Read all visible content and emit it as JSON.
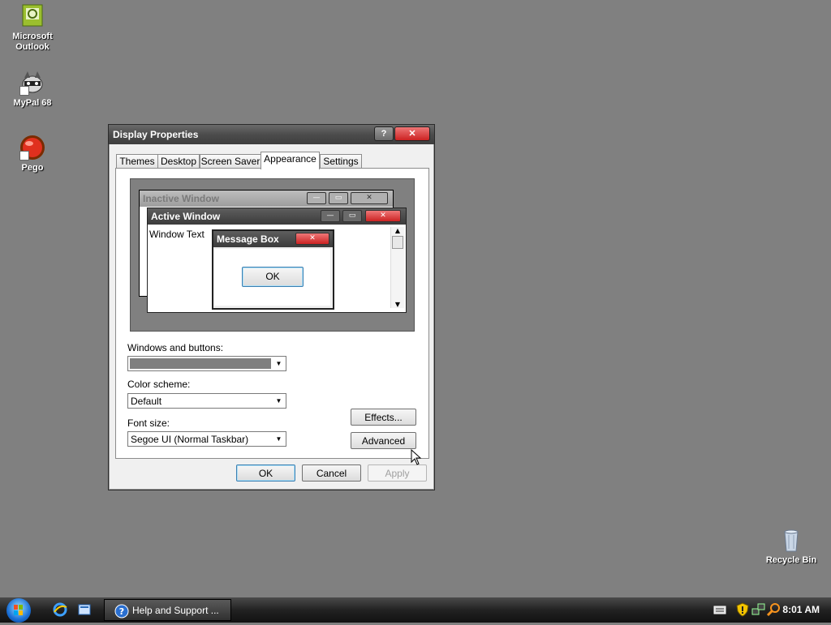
{
  "desktop": {
    "icons": [
      {
        "label_line1": "Microsoft",
        "label_line2": "Outlook"
      },
      {
        "label_line1": "MyPal 68",
        "label_line2": ""
      },
      {
        "label_line1": "Pego",
        "label_line2": ""
      },
      {
        "label_line1": "Recycle Bin",
        "label_line2": ""
      }
    ]
  },
  "dialog": {
    "title": "Display Properties",
    "help_glyph": "?",
    "close_glyph": "✕",
    "tabs": [
      "Themes",
      "Desktop",
      "Screen Saver",
      "Appearance",
      "Settings"
    ],
    "active_tab": "Appearance",
    "preview": {
      "inactive_title": "Inactive Window",
      "active_title": "Active Window",
      "window_text": "Window Text",
      "message_box_title": "Message Box",
      "ok_label": "OK"
    },
    "windows_buttons_label": "Windows and buttons:",
    "windows_buttons_value": "",
    "color_scheme_label": "Color scheme:",
    "color_scheme_value": "Default",
    "font_size_label": "Font size:",
    "font_size_value": "Segoe UI (Normal Taskbar)",
    "effects_label": "Effects...",
    "advanced_label": "Advanced",
    "ok_label": "OK",
    "cancel_label": "Cancel",
    "apply_label": "Apply"
  },
  "taskbar": {
    "task_label": "Help and Support ...",
    "clock": "8:01 AM"
  },
  "colors": {
    "desktop_bg": "#808080",
    "titlebar_dark": "#4c4c4c",
    "active_title": "#3b3b3b",
    "inactive_title": "#9d9d9d",
    "close_red": "#c83232"
  }
}
